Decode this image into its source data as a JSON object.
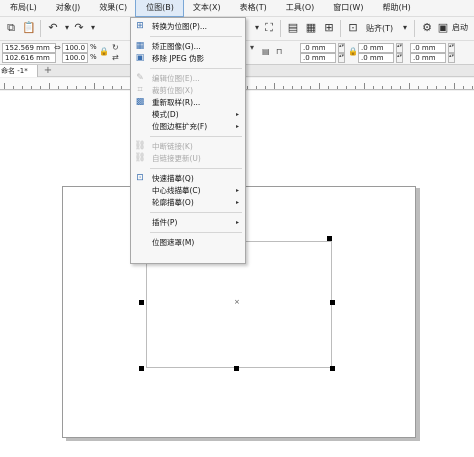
{
  "menubar": {
    "items": [
      {
        "label": "布局(L)"
      },
      {
        "label": "对象(J)"
      },
      {
        "label": "效果(C)"
      },
      {
        "label": "位图(B)",
        "active": true
      },
      {
        "label": "文本(X)"
      },
      {
        "label": "表格(T)"
      },
      {
        "label": "工具(O)"
      },
      {
        "label": "窗口(W)"
      },
      {
        "label": "帮助(H)"
      }
    ]
  },
  "toolbar": {
    "snap_label": "贴齐(T)",
    "launch_label": "启动"
  },
  "propbar": {
    "x_value": "152.569 mm",
    "y_value": "102.616 mm",
    "scale_w": "100.0",
    "scale_h": "100.0",
    "percent": "%",
    "right_field_1": ".0 mm",
    "right_field_2": ".0 mm",
    "right_field_3": ".0 mm",
    "right_field_4": ".0 mm",
    "right_field_5": ".0 mm",
    "right_field_6": ".0 mm"
  },
  "tabs": {
    "doc_tab": "命名 -1*",
    "add_symbol": "+"
  },
  "canvas": {
    "center_symbol": "×"
  },
  "dropdown": {
    "items": [
      {
        "label": "转换为位图(P)...",
        "icon": "convert-bitmap-icon",
        "glyph": "⊞",
        "enabled": true
      },
      {
        "label": "",
        "type": "separator"
      },
      {
        "label": "矫正图像(G)...",
        "icon": "straighten-image-icon",
        "glyph": "▦",
        "enabled": true
      },
      {
        "label": "移除 JPEG 伪影",
        "icon": "remove-jpeg-icon",
        "glyph": "▣",
        "enabled": true
      },
      {
        "label": "",
        "type": "separator"
      },
      {
        "label": "编辑位图(E)...",
        "icon": "edit-bitmap-icon",
        "glyph": "✎",
        "enabled": false
      },
      {
        "label": "裁剪位图(X)",
        "icon": "crop-bitmap-icon",
        "glyph": "⌗",
        "enabled": false
      },
      {
        "label": "重新取样(R)...",
        "icon": "resample-icon",
        "glyph": "▩",
        "enabled": true
      },
      {
        "label": "模式(D)",
        "icon": "",
        "glyph": "",
        "enabled": true,
        "submenu": true
      },
      {
        "label": "位图边框扩充(F)",
        "icon": "",
        "glyph": "",
        "enabled": true,
        "submenu": true
      },
      {
        "label": "",
        "type": "separator"
      },
      {
        "label": "中断链接(K)",
        "icon": "break-link-icon",
        "glyph": "⛓",
        "enabled": false
      },
      {
        "label": "自链接更新(U)",
        "icon": "update-link-icon",
        "glyph": "⛓",
        "enabled": false
      },
      {
        "label": "",
        "type": "separator"
      },
      {
        "label": "快速描摹(Q)",
        "icon": "quick-trace-icon",
        "glyph": "⊡",
        "enabled": true
      },
      {
        "label": "中心线描摹(C)",
        "icon": "",
        "glyph": "",
        "enabled": true,
        "submenu": true
      },
      {
        "label": "轮廓描摹(O)",
        "icon": "",
        "glyph": "",
        "enabled": true,
        "submenu": true
      },
      {
        "label": "",
        "type": "separator"
      },
      {
        "label": "插件(P)",
        "icon": "",
        "glyph": "",
        "enabled": true,
        "submenu": true
      },
      {
        "label": "",
        "type": "separator"
      },
      {
        "label": "位图遮罩(M)",
        "icon": "",
        "glyph": "",
        "enabled": true
      }
    ],
    "arrow_glyph": "▸"
  }
}
